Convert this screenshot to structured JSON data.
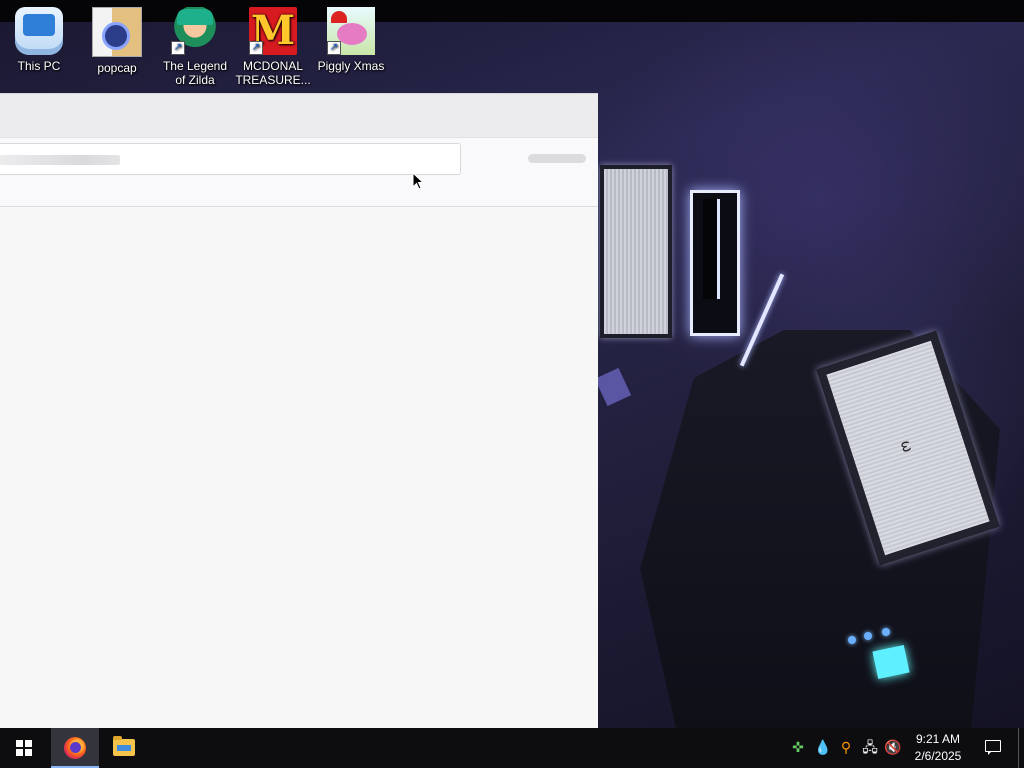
{
  "desktop": {
    "icons": [
      {
        "label": "This PC",
        "icon": "computer-icon",
        "shortcut": false
      },
      {
        "label": "popcap",
        "icon": "popcap-folder-icon",
        "shortcut": false
      },
      {
        "label": "The Legend of Zilda",
        "icon": "zilda-game-icon",
        "shortcut": true
      },
      {
        "label": "MCDONAL TREASURE...",
        "icon": "mcdonalds-icon",
        "shortcut": true
      },
      {
        "label": "Piggly Xmas",
        "icon": "piggy-game-icon",
        "shortcut": true
      }
    ],
    "wallpaper_face": "ω"
  },
  "window": {
    "state": "loading",
    "address_bar_value": ""
  },
  "taskbar": {
    "pinned": [
      {
        "name": "Firefox",
        "icon": "firefox-icon",
        "active": true
      },
      {
        "name": "File Explorer",
        "icon": "folder-icon",
        "active": false
      }
    ],
    "tray_icons": [
      "security-icon",
      "droplet-icon",
      "search-tool-icon",
      "network-icon",
      "volume-muted-icon"
    ],
    "clock": {
      "time": "9:21 AM",
      "date": "2/6/2025"
    }
  },
  "colors": {
    "taskbar": "#0d0d10",
    "accent": "#8ab4f8",
    "window_bg": "#f7f7f8"
  }
}
